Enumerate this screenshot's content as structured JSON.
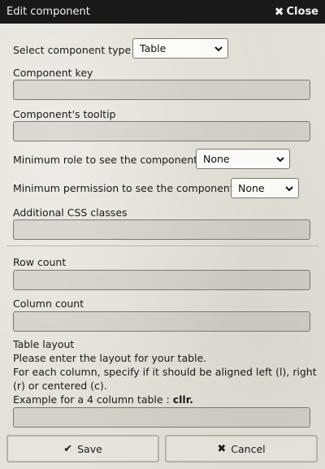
{
  "window": {
    "title": "Edit component",
    "close_label": "Close"
  },
  "form": {
    "component_type_label": "Select component type",
    "component_type_value": "Table",
    "component_key_label": "Component key",
    "component_key_value": "",
    "tooltip_label": "Component's tooltip",
    "tooltip_value": "",
    "min_role_label": "Minimum role to see the component",
    "min_role_value": "None",
    "min_permission_label": "Minimum permission to see the component",
    "min_permission_value": "None",
    "css_classes_label": "Additional CSS classes",
    "css_classes_value": "",
    "row_count_label": "Row count",
    "row_count_value": "",
    "column_count_label": "Column count",
    "column_count_value": "",
    "table_layout_label": "Table layout",
    "help_line_1": "Please enter the layout for your table.",
    "help_line_2": "For each column, specify if it should be aligned left (l), right",
    "help_line_3": "(r) or centered (c).",
    "help_line_4_prefix": "Example for a 4 column table : ",
    "help_line_4_example": "cllr.",
    "table_layout_value": ""
  },
  "buttons": {
    "save_label": "Save",
    "cancel_label": "Cancel"
  },
  "icons": {
    "close": "close-x-icon",
    "save": "check-icon",
    "cancel": "x-icon",
    "dropdown": "chevron-down-icon"
  }
}
